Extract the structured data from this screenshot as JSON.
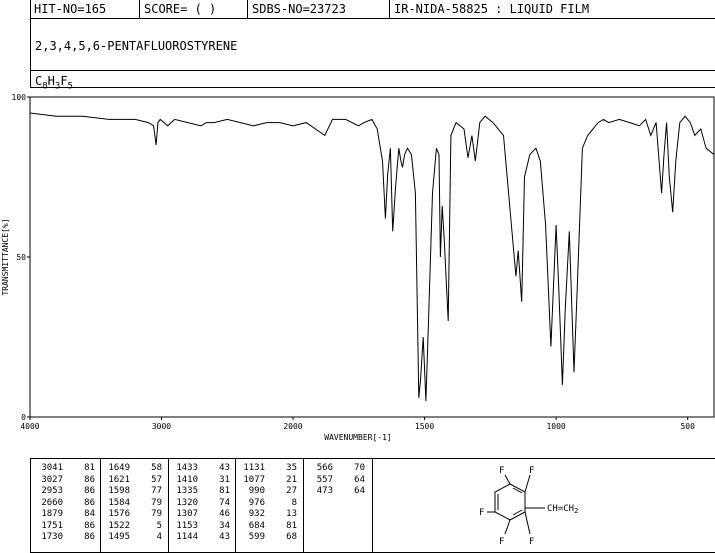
{
  "header": {
    "hit_no": "HIT-NO=165",
    "score": "SCORE=  (   )",
    "sdbs_no": "SDBS-NO=23723",
    "ir_no": "IR-NIDA-58825 : LIQUID FILM"
  },
  "compound_name": "2,3,4,5,6-PENTAFLUOROSTYRENE",
  "formula": {
    "c": "C",
    "c_n": "8",
    "h": "H",
    "h_n": "3",
    "f": "F",
    "f_n": "5"
  },
  "chart_data": {
    "type": "line",
    "xlabel": "WAVENUMBER[-1]",
    "ylabel": "TRANSMITTANCE[%]",
    "xlim": [
      4000,
      400
    ],
    "ylim": [
      0,
      100
    ],
    "x_ticks": [
      4000,
      3000,
      2000,
      1500,
      1000,
      500
    ],
    "y_ticks": [
      0,
      50,
      100
    ],
    "series": [
      {
        "x": [
          4000,
          3800,
          3600,
          3400,
          3200,
          3100,
          3060,
          3041,
          3027,
          3010,
          2953,
          2900,
          2800,
          2700,
          2660,
          2600,
          2500,
          2400,
          2300,
          2200,
          2100,
          2000,
          1950,
          1879,
          1850,
          1800,
          1751,
          1730,
          1700,
          1680,
          1660,
          1649,
          1640,
          1630,
          1621,
          1610,
          1598,
          1590,
          1584,
          1576,
          1565,
          1550,
          1535,
          1522,
          1515,
          1505,
          1495,
          1485,
          1470,
          1455,
          1445,
          1440,
          1433,
          1425,
          1410,
          1400,
          1380,
          1350,
          1335,
          1320,
          1307,
          1290,
          1270,
          1240,
          1200,
          1170,
          1153,
          1144,
          1131,
          1120,
          1100,
          1077,
          1060,
          1040,
          1020,
          1000,
          990,
          976,
          965,
          950,
          932,
          920,
          900,
          880,
          860,
          840,
          820,
          800,
          760,
          720,
          684,
          660,
          640,
          620,
          599,
          590,
          580,
          570,
          557,
          545,
          530,
          510,
          490,
          473,
          450,
          430,
          400
        ],
        "y": [
          95,
          94,
          94,
          93,
          93,
          92,
          91,
          85,
          92,
          93,
          91,
          93,
          92,
          91,
          92,
          92,
          93,
          92,
          91,
          92,
          92,
          91,
          92,
          88,
          93,
          93,
          91,
          92,
          93,
          90,
          80,
          62,
          76,
          84,
          58,
          72,
          84,
          80,
          78,
          82,
          84,
          82,
          70,
          6,
          12,
          25,
          5,
          30,
          70,
          84,
          82,
          50,
          66,
          55,
          30,
          88,
          92,
          90,
          81,
          88,
          80,
          92,
          94,
          92,
          88,
          60,
          44,
          52,
          36,
          75,
          82,
          84,
          80,
          60,
          22,
          60,
          40,
          10,
          34,
          58,
          14,
          40,
          84,
          88,
          90,
          92,
          93,
          92,
          93,
          92,
          91,
          93,
          88,
          92,
          70,
          82,
          92,
          75,
          64,
          80,
          92,
          94,
          92,
          88,
          90,
          84,
          82
        ]
      }
    ]
  },
  "peaks": [
    [
      [
        "3041",
        "81"
      ],
      [
        "3027",
        "86"
      ],
      [
        "2953",
        "86"
      ],
      [
        "2660",
        "86"
      ],
      [
        "1879",
        "84"
      ],
      [
        "1751",
        "86"
      ],
      [
        "1730",
        "86"
      ]
    ],
    [
      [
        "1649",
        "58"
      ],
      [
        "1621",
        "57"
      ],
      [
        "1598",
        "77"
      ],
      [
        "1584",
        "79"
      ],
      [
        "1576",
        "79"
      ],
      [
        "1522",
        "5"
      ],
      [
        "1495",
        "4"
      ]
    ],
    [
      [
        "1433",
        "43"
      ],
      [
        "1410",
        "31"
      ],
      [
        "1335",
        "81"
      ],
      [
        "1320",
        "74"
      ],
      [
        "1307",
        "46"
      ],
      [
        "1153",
        "34"
      ],
      [
        "1144",
        "43"
      ]
    ],
    [
      [
        "1131",
        "35"
      ],
      [
        "1077",
        "21"
      ],
      [
        "990",
        "27"
      ],
      [
        "976",
        "8"
      ],
      [
        "932",
        "13"
      ],
      [
        "684",
        "81"
      ],
      [
        "599",
        "68"
      ]
    ],
    [
      [
        "566",
        "70"
      ],
      [
        "557",
        "64"
      ],
      [
        "473",
        "64"
      ]
    ]
  ],
  "structure": {
    "f_labels": [
      "F",
      "F",
      "F",
      "F",
      "F"
    ],
    "vinyl": "CH=CH",
    "vinyl_sub": "2"
  }
}
